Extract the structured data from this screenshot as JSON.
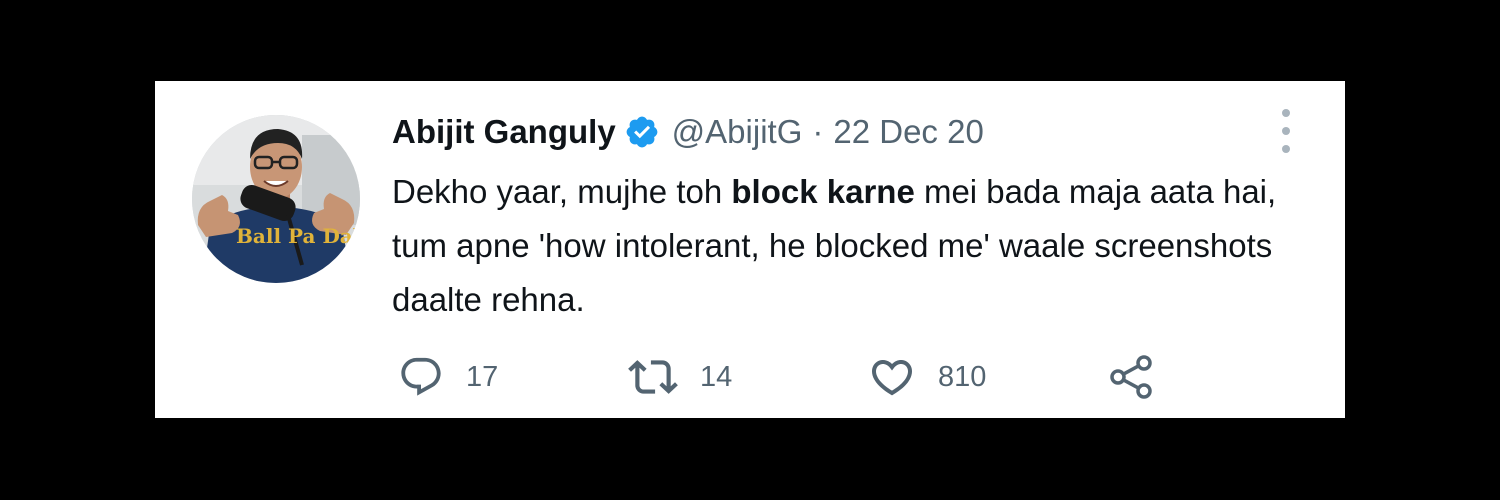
{
  "tweet": {
    "display_name": "Abijit Ganguly",
    "handle": "@AbijitG",
    "separator": "·",
    "date": "22 Dec 20",
    "verified": true,
    "text_before": "Dekho yaar, mujhe toh ",
    "text_bold": "block karne",
    "text_after": " mei bada maja aata hai, tum apne 'how intolerant, he blocked me' waale screenshots daalte rehna.",
    "avatar_shirt_text": "Ball Pa Dabb..."
  },
  "actions": {
    "reply_count": "17",
    "retweet_count": "14",
    "like_count": "810"
  },
  "icons": {
    "verified": "verified-badge-icon",
    "more": "more-options-icon",
    "reply": "reply-icon",
    "retweet": "retweet-icon",
    "like": "heart-icon",
    "share": "share-icon"
  },
  "colors": {
    "background": "#000000",
    "card": "#ffffff",
    "primary_text": "#0f1419",
    "secondary_text": "#536471",
    "verified_blue": "#1d9bf0",
    "more_dots": "#a9b4bd"
  }
}
